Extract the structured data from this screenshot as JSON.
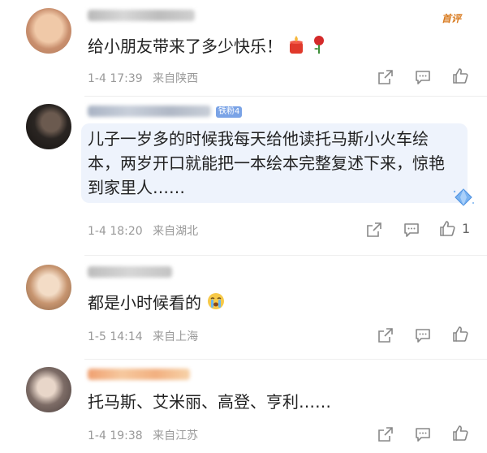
{
  "comments": [
    {
      "author_badge": "首评",
      "text": "给小朋友带来了多少快乐！",
      "emojis": [
        "candle-emoji",
        "rose-emoji"
      ],
      "date": "1-4 17:39",
      "location": "来自陕西",
      "likes": ""
    },
    {
      "fan_badge": "铁粉4",
      "text_lines": [
        "儿子一岁多的时候我每天给他读托马斯小火车绘",
        "本，两岁开口就能把一本绘本完整复述下来，惊艳",
        "到家里人……"
      ],
      "date": "1-4 18:20",
      "location": "来自湖北",
      "likes": "1"
    },
    {
      "text": "都是小时候看的",
      "emojis": [
        "crying-emoji"
      ],
      "date": "1-5 14:14",
      "location": "来自上海",
      "likes": ""
    },
    {
      "text": "托马斯、艾米丽、高登、亨利……",
      "date": "1-4 19:38",
      "location": "来自江苏",
      "likes": ""
    }
  ],
  "colors": {
    "meta": "#999999",
    "bubble": "#eef3fc",
    "accent": "#d87a1e",
    "badge": "#7aa3e6"
  }
}
